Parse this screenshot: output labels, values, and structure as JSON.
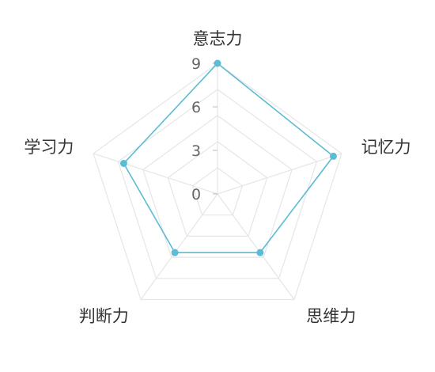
{
  "chart_data": {
    "type": "radar",
    "title": "",
    "axes": [
      "意志力",
      "记忆力",
      "思维力",
      "判断力",
      "学习力"
    ],
    "rmin": 0,
    "rmax": 9,
    "ticks": [
      0,
      3,
      6,
      9
    ],
    "grid": true,
    "series": [
      {
        "values": [
          9,
          8.4,
          5,
          5,
          6.8
        ]
      }
    ]
  },
  "colors": {
    "series": "#5bbcd3",
    "grid": "#e6e6e6",
    "tick_text": "#666666",
    "axis_text": "#333333"
  }
}
